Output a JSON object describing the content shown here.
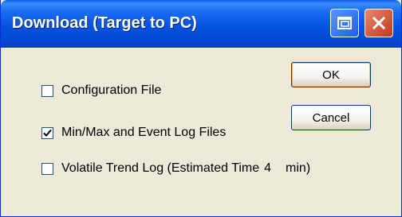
{
  "window": {
    "title": "Download (Target to PC)",
    "icons": {
      "restore": "restore-window-icon",
      "close": "close-x-icon"
    }
  },
  "options": [
    {
      "label": "Configuration File",
      "checked": false
    },
    {
      "label": "Min/Max and Event Log Files",
      "checked": true
    },
    {
      "label": "Volatile Trend Log (Estimated Time",
      "checked": false,
      "estimate": "4",
      "unit": "min)"
    }
  ],
  "buttons": {
    "ok": "OK",
    "cancel": "Cancel"
  },
  "colors": {
    "titlebar": "#0553e0",
    "face": "#ece9d8",
    "close": "#c1391b",
    "button_border": "#003c74"
  }
}
